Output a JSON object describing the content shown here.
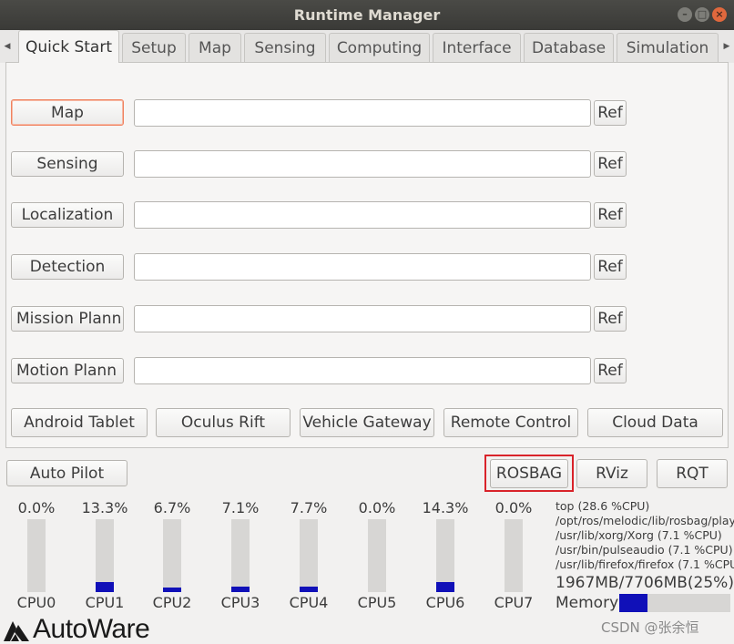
{
  "window": {
    "title": "Runtime Manager"
  },
  "tabs": [
    "Quick Start",
    "Setup",
    "Map",
    "Sensing",
    "Computing",
    "Interface",
    "Database",
    "Simulation"
  ],
  "quick_start": {
    "rows": [
      {
        "label": "Map",
        "value": "",
        "ref": "Ref"
      },
      {
        "label": "Sensing",
        "value": "",
        "ref": "Ref"
      },
      {
        "label": "Localization",
        "value": "",
        "ref": "Ref"
      },
      {
        "label": "Detection",
        "value": "",
        "ref": "Ref"
      },
      {
        "label": "Mission Plann",
        "value": "",
        "ref": "Ref"
      },
      {
        "label": "Motion Plann",
        "value": "",
        "ref": "Ref"
      }
    ],
    "tools": [
      "Android Tablet",
      "Oculus Rift",
      "Vehicle Gateway",
      "Remote Control",
      "Cloud Data"
    ]
  },
  "bottom_buttons": {
    "auto_pilot": "Auto Pilot",
    "rosbag": "ROSBAG",
    "rviz": "RViz",
    "rqt": "RQT"
  },
  "cpus": [
    {
      "label": "CPU0",
      "percent_text": "0.0%",
      "percent": 0.0
    },
    {
      "label": "CPU1",
      "percent_text": "13.3%",
      "percent": 13.3
    },
    {
      "label": "CPU2",
      "percent_text": "6.7%",
      "percent": 6.7
    },
    {
      "label": "CPU3",
      "percent_text": "7.1%",
      "percent": 7.1
    },
    {
      "label": "CPU4",
      "percent_text": "7.7%",
      "percent": 7.7
    },
    {
      "label": "CPU5",
      "percent_text": "0.0%",
      "percent": 0.0
    },
    {
      "label": "CPU6",
      "percent_text": "14.3%",
      "percent": 14.3
    },
    {
      "label": "CPU7",
      "percent_text": "0.0%",
      "percent": 0.0
    }
  ],
  "top_processes": [
    "top (28.6 %CPU)",
    "/opt/ros/melodic/lib/rosbag/play",
    "/usr/lib/xorg/Xorg (7.1 %CPU)",
    "/usr/bin/pulseaudio (7.1 %CPU)",
    "/usr/lib/firefox/firefox (7.1 %CPU)"
  ],
  "memory": {
    "text": "1967MB/7706MB(25%)",
    "label": "Memory",
    "percent": 25
  },
  "logo": {
    "text": "AutoWare"
  },
  "watermark": "CSDN @张余恒",
  "colors": {
    "bar_fill": "#1010b8",
    "focus_border": "#f0825f",
    "highlight": "#d9232a"
  }
}
